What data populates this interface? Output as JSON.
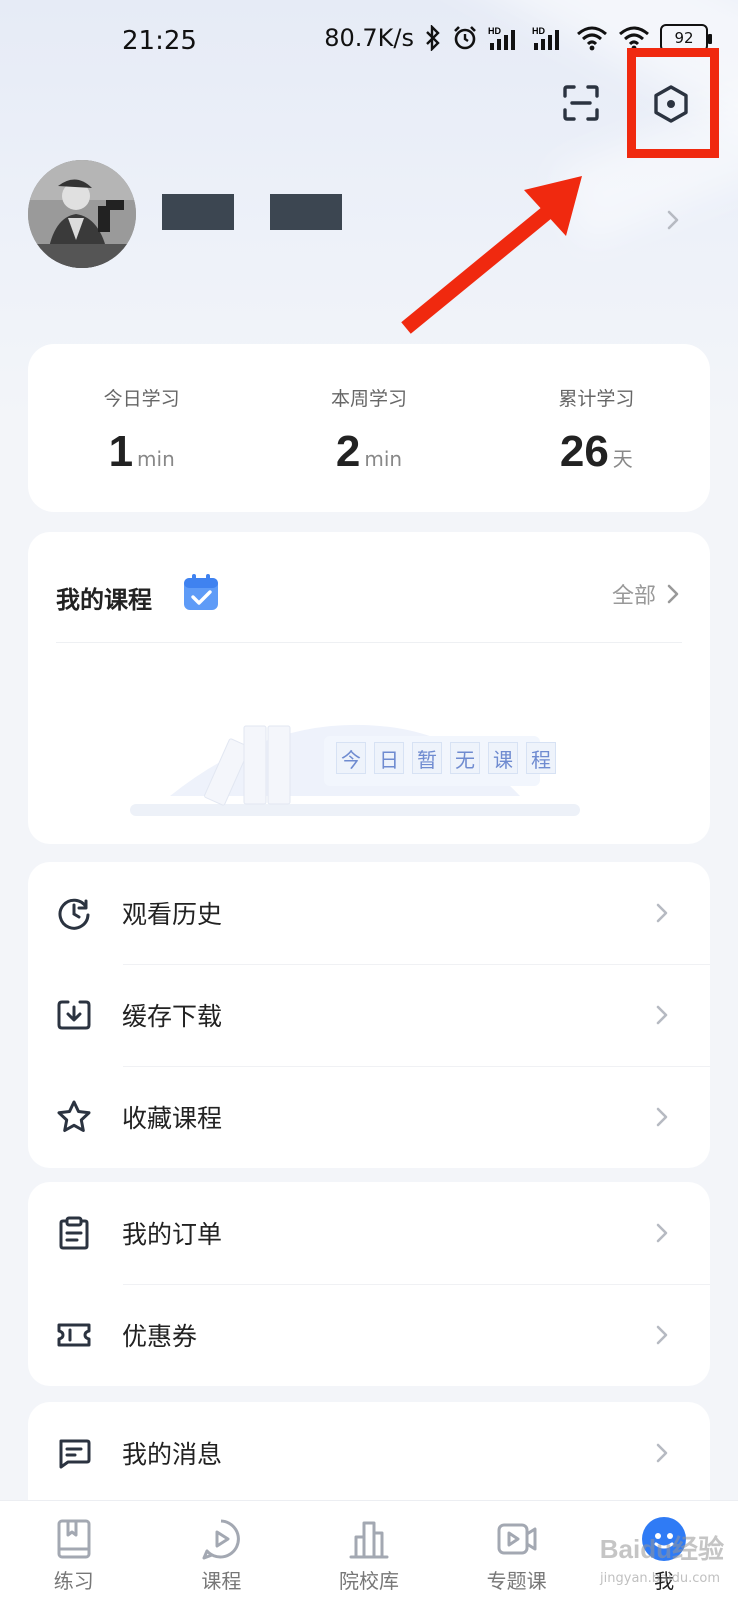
{
  "status_bar": {
    "time": "21:25",
    "speed": "80.7K/s",
    "battery": "92"
  },
  "header": {
    "scan_icon": "scan-icon",
    "settings_icon": "hexagon-settings-icon"
  },
  "stats": [
    {
      "label": "今日学习",
      "value": "1",
      "unit": "min"
    },
    {
      "label": "本周学习",
      "value": "2",
      "unit": "min"
    },
    {
      "label": "累计学习",
      "value": "26",
      "unit": "天"
    }
  ],
  "my_courses": {
    "title": "我的课程",
    "all_label": "全部",
    "empty_chars": [
      "今",
      "日",
      "暂",
      "无",
      "课",
      "程"
    ]
  },
  "menu_group1": [
    {
      "label": "观看历史",
      "icon": "clock-icon"
    },
    {
      "label": "缓存下载",
      "icon": "download-icon"
    },
    {
      "label": "收藏课程",
      "icon": "star-icon"
    }
  ],
  "menu_group2": [
    {
      "label": "我的订单",
      "icon": "order-icon"
    },
    {
      "label": "优惠券",
      "icon": "coupon-icon"
    }
  ],
  "menu_group3": [
    {
      "label": "我的消息",
      "icon": "message-icon"
    }
  ],
  "bottom_nav": [
    {
      "label": "练习",
      "icon": "book-icon"
    },
    {
      "label": "课程",
      "icon": "play-bubble-icon"
    },
    {
      "label": "院校库",
      "icon": "building-icon"
    },
    {
      "label": "专题课",
      "icon": "video-camera-icon"
    },
    {
      "label": "我",
      "icon": "robot-face-icon"
    }
  ],
  "watermark": {
    "text": "Baidu经验",
    "sub": "jingyan.baidu.com"
  },
  "colors": {
    "accent": "#2f7bf5",
    "highlight": "#f0290f"
  }
}
